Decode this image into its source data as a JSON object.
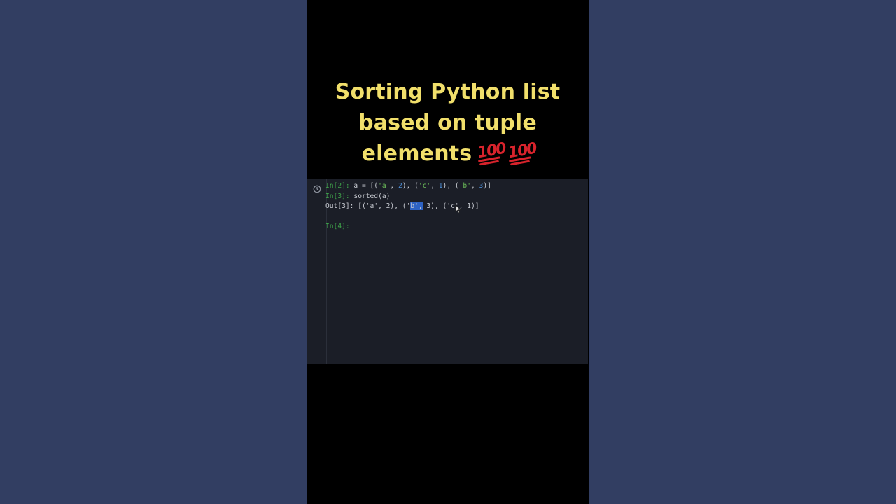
{
  "video": {
    "title_lines": [
      "Sorting Python list",
      "based on tuple",
      "elements"
    ],
    "title_emojis": [
      "💯",
      "💯"
    ]
  },
  "terminal": {
    "lines": [
      {
        "prompt": "In[2]:",
        "segments": [
          {
            "text": " a = [(",
            "kind": "plain"
          },
          {
            "text": "'a'",
            "kind": "str"
          },
          {
            "text": ", ",
            "kind": "plain"
          },
          {
            "text": "2",
            "kind": "num"
          },
          {
            "text": "), (",
            "kind": "plain"
          },
          {
            "text": "'c'",
            "kind": "str"
          },
          {
            "text": ", ",
            "kind": "plain"
          },
          {
            "text": "1",
            "kind": "num"
          },
          {
            "text": "), (",
            "kind": "plain"
          },
          {
            "text": "'b'",
            "kind": "str"
          },
          {
            "text": ", ",
            "kind": "plain"
          },
          {
            "text": "3",
            "kind": "num"
          },
          {
            "text": ")]",
            "kind": "plain"
          }
        ]
      },
      {
        "prompt": "In[3]:",
        "segments": [
          {
            "text": " sorted(a)",
            "kind": "plain"
          }
        ]
      },
      {
        "prompt": "Out[3]:",
        "segments": [
          {
            "text": " [('a', 2), ('",
            "kind": "plain"
          },
          {
            "text": "b',",
            "kind": "hl"
          },
          {
            "text": " 3), ('c', 1)]",
            "kind": "plain"
          }
        ]
      },
      {
        "prompt": "",
        "segments": []
      },
      {
        "prompt": "In[4]:",
        "segments": []
      }
    ]
  },
  "colors": {
    "page_bg": "#323e62",
    "title": "#f1df6b",
    "terminal_bg": "#1b1e27",
    "prompt_in": "#3fa34a",
    "string": "#6dbf5a",
    "number": "#4d8fd8",
    "selection": "#2e63c4"
  }
}
